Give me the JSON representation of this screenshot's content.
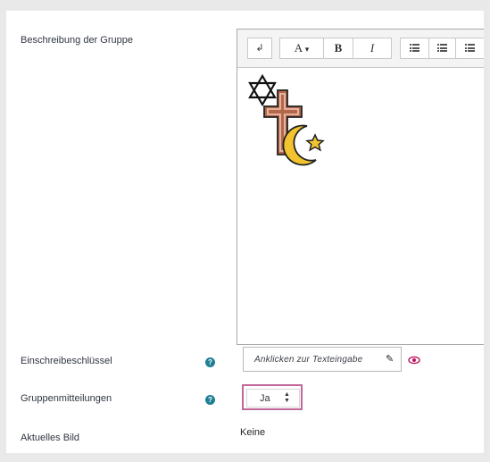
{
  "form": {
    "description": {
      "label": "Beschreibung der Gruppe"
    },
    "toolbar": {
      "undo_icon": "↲",
      "font_label": "A",
      "dropdown_glyph": "▾",
      "bold_label": "B",
      "italic_label": "I",
      "buttons": [
        "bullet-list-icon",
        "numbered-list-icon",
        "align-icon"
      ]
    },
    "editor_image": {
      "symbols": [
        "star-of-david-icon",
        "cross-icon",
        "crescent-star-icon"
      ]
    },
    "enrolment_key": {
      "label": "Einschreibeschlüssel",
      "placeholder": "Anklicken zur Texteingabe",
      "edit_icon": "✎",
      "reveal_icon": "eye-icon"
    },
    "group_messaging": {
      "label": "Gruppenmitteilungen",
      "selected": "Ja"
    },
    "current_picture": {
      "label": "Aktuelles Bild",
      "value": "Keine"
    },
    "help_icon_glyph": "?",
    "colors": {
      "accent": "#c2679b",
      "help": "#1f7f95",
      "eye": "#c0135e"
    }
  }
}
